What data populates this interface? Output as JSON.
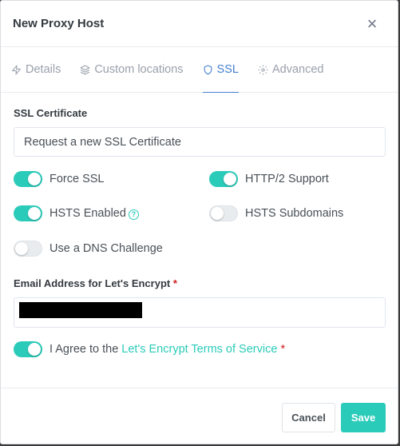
{
  "modal": {
    "title": "New Proxy Host",
    "close_icon": "×"
  },
  "tabs": [
    {
      "label": "Details",
      "icon": "zap-icon"
    },
    {
      "label": "Custom locations",
      "icon": "layers-icon"
    },
    {
      "label": "SSL",
      "icon": "shield-icon",
      "active": true
    },
    {
      "label": "Advanced",
      "icon": "gear-icon"
    }
  ],
  "ssl": {
    "certificate_label": "SSL Certificate",
    "certificate_value": "Request a new SSL Certificate",
    "force_ssl": {
      "label": "Force SSL",
      "on": true
    },
    "http2": {
      "label": "HTTP/2 Support",
      "on": true
    },
    "hsts": {
      "label": "HSTS Enabled",
      "on": true,
      "help": "?"
    },
    "hsts_sub": {
      "label": "HSTS Subdomains",
      "on": false
    },
    "dns_challenge": {
      "label": "Use a DNS Challenge",
      "on": false
    },
    "email_label": "Email Address for Let's Encrypt",
    "required_mark": "*",
    "email_value": "",
    "agree": {
      "prefix": "I Agree to the ",
      "link": "Let's Encrypt Terms of Service",
      "on": true
    }
  },
  "footer": {
    "cancel_label": "Cancel",
    "save_label": "Save"
  },
  "colors": {
    "accent": "#2bcbba",
    "tab_active": "#467fcf",
    "required": "#cd201f"
  }
}
